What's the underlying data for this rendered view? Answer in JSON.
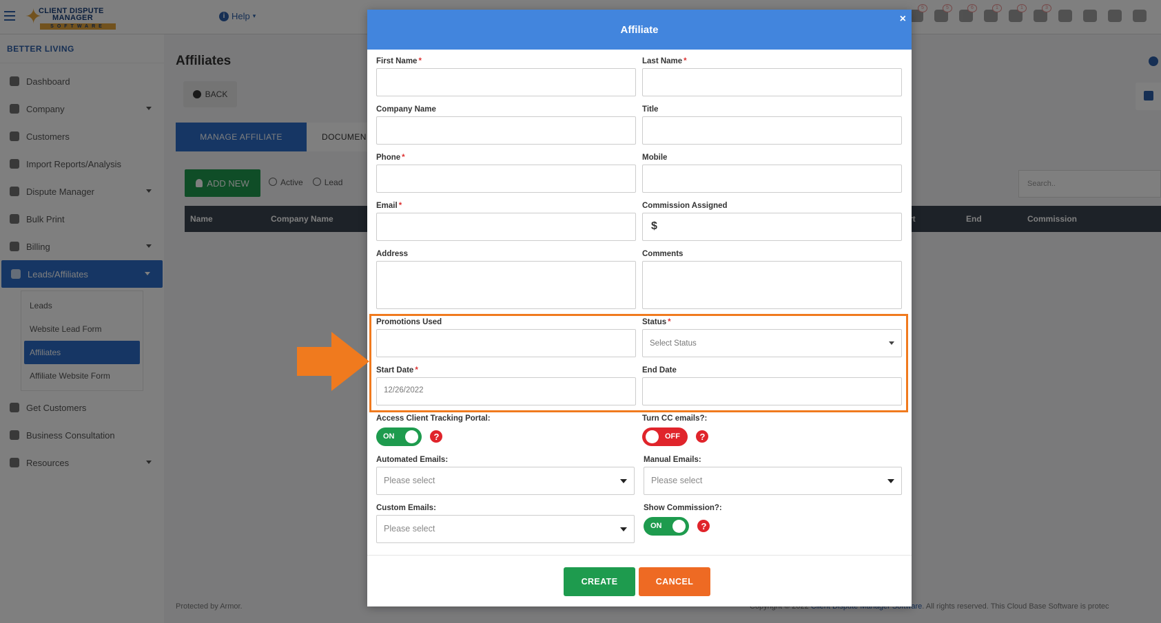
{
  "topbar": {
    "logo": {
      "line1": "CLIENT DISPUTE",
      "line2": "MANAGER",
      "line3": "SOFTWARE"
    },
    "help_label": "Help",
    "badges": [
      "5",
      "5",
      "6",
      "1",
      "1",
      "3"
    ]
  },
  "sidebar": {
    "company": "BETTER LIVING",
    "items": [
      {
        "label": "Dashboard"
      },
      {
        "label": "Company"
      },
      {
        "label": "Customers"
      },
      {
        "label": "Import Reports/Analysis"
      },
      {
        "label": "Dispute Manager"
      },
      {
        "label": "Bulk Print"
      },
      {
        "label": "Billing"
      },
      {
        "label": "Leads/Affiliates"
      },
      {
        "label": "Get Customers"
      },
      {
        "label": "Business Consultation"
      },
      {
        "label": "Resources"
      }
    ],
    "sub_items": [
      {
        "label": "Leads"
      },
      {
        "label": "Website Lead Form"
      },
      {
        "label": "Affiliates"
      },
      {
        "label": "Affiliate Website Form"
      }
    ]
  },
  "main": {
    "title": "Affiliates",
    "back_label": "BACK",
    "tabs": [
      {
        "label": "MANAGE AFFILIATE"
      },
      {
        "label": "DOCUMEN"
      }
    ],
    "add_new_label": "ADD NEW",
    "radios": [
      "Active",
      "Lead"
    ],
    "search_placeholder": "Search..",
    "columns": [
      "Name",
      "Company Name",
      "rt",
      "End",
      "Commission"
    ],
    "footer_left": "Protected by Armor.",
    "footer_right_pre": "Copyright © 2022 ",
    "footer_right_link": "Client Dispute Manager Software",
    "footer_right_post": ". All rights reserved. This Cloud Base Software is protec"
  },
  "modal": {
    "title": "Affiliate",
    "close": "×",
    "fields": {
      "first_name": {
        "label": "First Name",
        "value": ""
      },
      "last_name": {
        "label": "Last Name",
        "value": ""
      },
      "company_name": {
        "label": "Company Name",
        "value": ""
      },
      "title": {
        "label": "Title",
        "value": ""
      },
      "phone": {
        "label": "Phone",
        "value": ""
      },
      "mobile": {
        "label": "Mobile",
        "value": ""
      },
      "email": {
        "label": "Email",
        "value": ""
      },
      "commission": {
        "label": "Commission Assigned",
        "prefix": "$",
        "value": ""
      },
      "address": {
        "label": "Address",
        "value": ""
      },
      "comments": {
        "label": "Comments",
        "value": ""
      },
      "promotions": {
        "label": "Promotions Used",
        "value": ""
      },
      "status": {
        "label": "Status",
        "value": "Select Status"
      },
      "start_date": {
        "label": "Start Date",
        "value": "12/26/2022"
      },
      "end_date": {
        "label": "End Date",
        "value": ""
      },
      "tracking_portal": {
        "label": "Access Client Tracking Portal:",
        "state": "ON"
      },
      "cc_emails": {
        "label": "Turn CC emails?:",
        "state": "OFF"
      },
      "automated_emails": {
        "label": "Automated Emails:",
        "value": "Please select"
      },
      "manual_emails": {
        "label": "Manual Emails:",
        "value": "Please select"
      },
      "custom_emails": {
        "label": "Custom Emails:",
        "value": "Please select"
      },
      "show_commission": {
        "label": "Show Commission?:",
        "state": "ON"
      }
    },
    "required_mark": "*",
    "help_mark": "?",
    "create_label": "CREATE",
    "cancel_label": "CANCEL"
  },
  "colors": {
    "header_blue": "#4285dd",
    "create_green": "#1e9b4e",
    "cancel_orange": "#ee6a23",
    "toggle_off_red": "#e0242b",
    "highlight_orange": "#f07a1e"
  }
}
